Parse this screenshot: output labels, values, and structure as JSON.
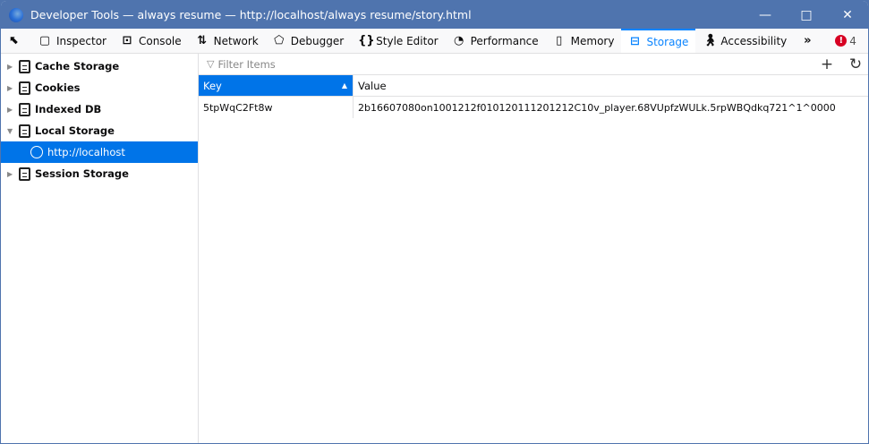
{
  "window": {
    "title": "Developer Tools — always resume — http://localhost/always resume/story.html"
  },
  "toolbar": {
    "tabs": [
      {
        "label": "Inspector",
        "icon": "inspector-icon"
      },
      {
        "label": "Console",
        "icon": "console-icon"
      },
      {
        "label": "Network",
        "icon": "network-icon"
      },
      {
        "label": "Debugger",
        "icon": "debugger-icon"
      },
      {
        "label": "Style Editor",
        "icon": "braces-icon"
      },
      {
        "label": "Performance",
        "icon": "gauge-icon"
      },
      {
        "label": "Memory",
        "icon": "chip-icon"
      },
      {
        "label": "Storage",
        "icon": "storage-icon",
        "selected": true
      },
      {
        "label": "Accessibility",
        "icon": "accessibility-icon"
      }
    ],
    "error_count": "4"
  },
  "sidebar": {
    "items": [
      {
        "label": "Cache Storage"
      },
      {
        "label": "Cookies"
      },
      {
        "label": "Indexed DB"
      },
      {
        "label": "Local Storage",
        "expanded": true
      },
      {
        "label": "http://localhost",
        "selected": true
      },
      {
        "label": "Session Storage"
      }
    ]
  },
  "filter": {
    "placeholder": "Filter Items"
  },
  "table": {
    "columns": [
      "Key",
      "Value"
    ],
    "rows": [
      {
        "key": "5tpWqC2Ft8w",
        "value": "2b16607080on1001212f010120111201212C10v_player.68VUpfzWULk.5rpWBQdkq721^1^0000"
      }
    ]
  },
  "colors": {
    "accent": "#0a84ff",
    "selection": "#0074e8",
    "titlebar": "#4f74ae"
  }
}
